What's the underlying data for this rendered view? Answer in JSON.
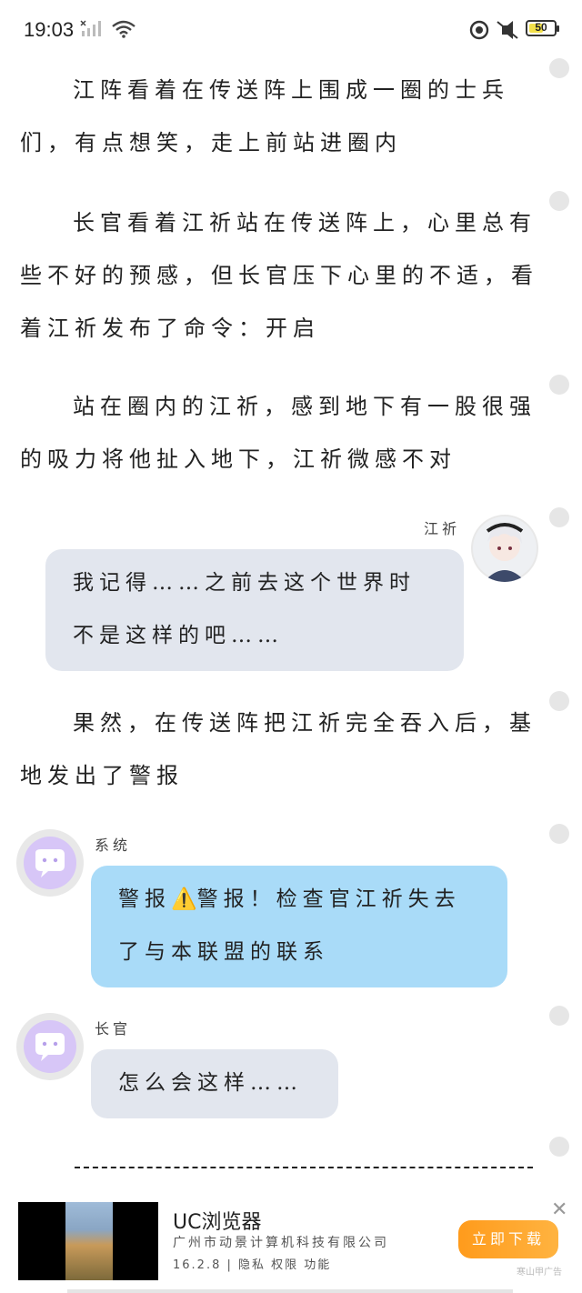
{
  "status_bar": {
    "time": "19:03",
    "battery": "50"
  },
  "story": {
    "p1": [
      "江阵看着在传送阵上围成一圈的士兵",
      "们，有点想笑，走上前站进圈内"
    ],
    "p2": [
      "长官看着江祈站在传送阵上，心里总有",
      "些不好的预感，但长官压下心里的不适，看",
      "着江祈发布了命令：开启"
    ],
    "p3": [
      "站在圈内的江祈，感到地下有一股很强",
      "的吸力将他扯入地下，江祈微感不对"
    ],
    "p4": [
      "果然，在传送阵把江祈完全吞入后，基",
      "地发出了警报"
    ]
  },
  "dialogs": {
    "jiangqi": {
      "speaker": "江祈",
      "lines": [
        "我记得……之前去这个世界时",
        "不是这样的吧……"
      ]
    },
    "system": {
      "speaker": "系统",
      "line1_a": "警报",
      "line1_icon": "⚠️",
      "line1_b": "警报！检查官江祈失去",
      "line2": "了与本联盟的联系"
    },
    "officer": {
      "speaker": "长官",
      "lines": [
        "怎么会这样……"
      ]
    }
  },
  "ad": {
    "app_name": "UC浏览器",
    "company": "广州市动景计算机科技有限公司",
    "meta": "16.2.8 | 隐私  权限  功能",
    "button": "立即下载",
    "close": "✕",
    "source": "寒山甲广告"
  },
  "colors": {
    "bubble_grey": "#e2e6ee",
    "bubble_blue": "#a9dbf8",
    "avatar_purple": "#d7c6f7",
    "ad_button": "#ff9b1c"
  },
  "icons": [
    "signal-icon",
    "wifi-icon",
    "circle-icon",
    "mute-icon",
    "battery-icon",
    "warning-icon",
    "comment-dot-icon",
    "close-icon"
  ]
}
